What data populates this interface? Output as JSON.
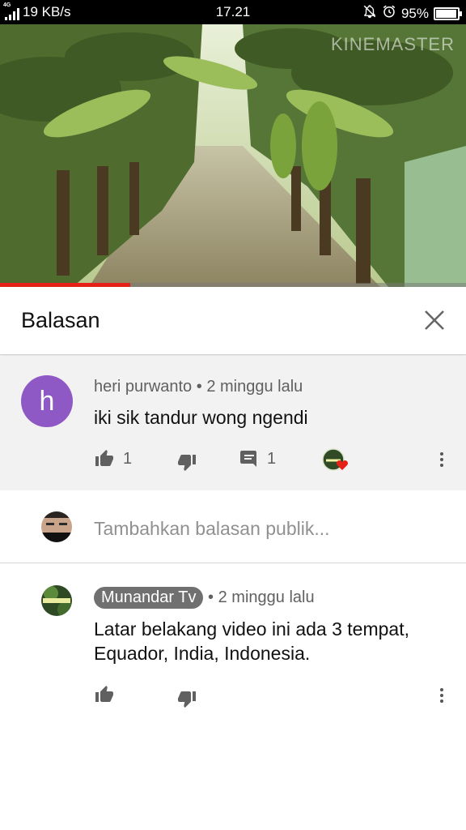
{
  "status": {
    "network": "4G",
    "speed": "19 KB/s",
    "time": "17.21",
    "battery": "95%",
    "battery_level": 0.95
  },
  "video": {
    "watermark": "KINEMASTER",
    "progress": 0.28
  },
  "panel": {
    "title": "Balasan",
    "close_icon": "close-icon"
  },
  "parent_comment": {
    "avatar_letter": "h",
    "avatar_color": "#8e58c5",
    "author": "heri purwanto",
    "separator": "•",
    "time": "2 minggu lalu",
    "text": "iki sik tandur wong ngendi",
    "likes": "1",
    "replies": "1",
    "heart_color": "#e62117"
  },
  "reply_box": {
    "placeholder": "Tambahkan balasan publik..."
  },
  "replies": [
    {
      "author": "Munandar Tv",
      "separator": "•",
      "time": "2 minggu lalu",
      "text_line1": "Latar belakang video ini ada 3 tempat,",
      "text_line2": "Equador, India, Indonesia."
    }
  ]
}
